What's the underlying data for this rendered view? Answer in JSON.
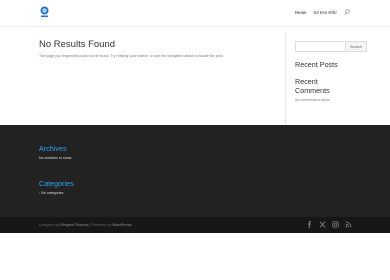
{
  "header": {
    "nav": [
      "Home",
      "K2 Kro Kthr"
    ]
  },
  "main": {
    "title": "No Results Found",
    "description": "The page you requested could not be found. Try refining your search, or use the navigation above to locate the post."
  },
  "sidebar": {
    "search_button": "Search",
    "recent_posts_title": "Recent Posts",
    "recent_comments_title": "Recent Comments",
    "recent_comments_text": "No comments to show."
  },
  "footer": {
    "archives_title": "Archives",
    "archives_text": "No archives to show.",
    "categories_title": "Categories",
    "categories_text": "No categories"
  },
  "bottom": {
    "designed_by": "Designed by",
    "theme_author": "Elegant Themes",
    "separator": " | Powered by ",
    "powered": "WordPress"
  },
  "social_icons": [
    "facebook-icon",
    "x-icon",
    "instagram-icon",
    "rss-icon"
  ],
  "colors": {
    "accent": "#2ea3f2",
    "footer_bg": "#222222",
    "bottom_bg": "#171717"
  }
}
